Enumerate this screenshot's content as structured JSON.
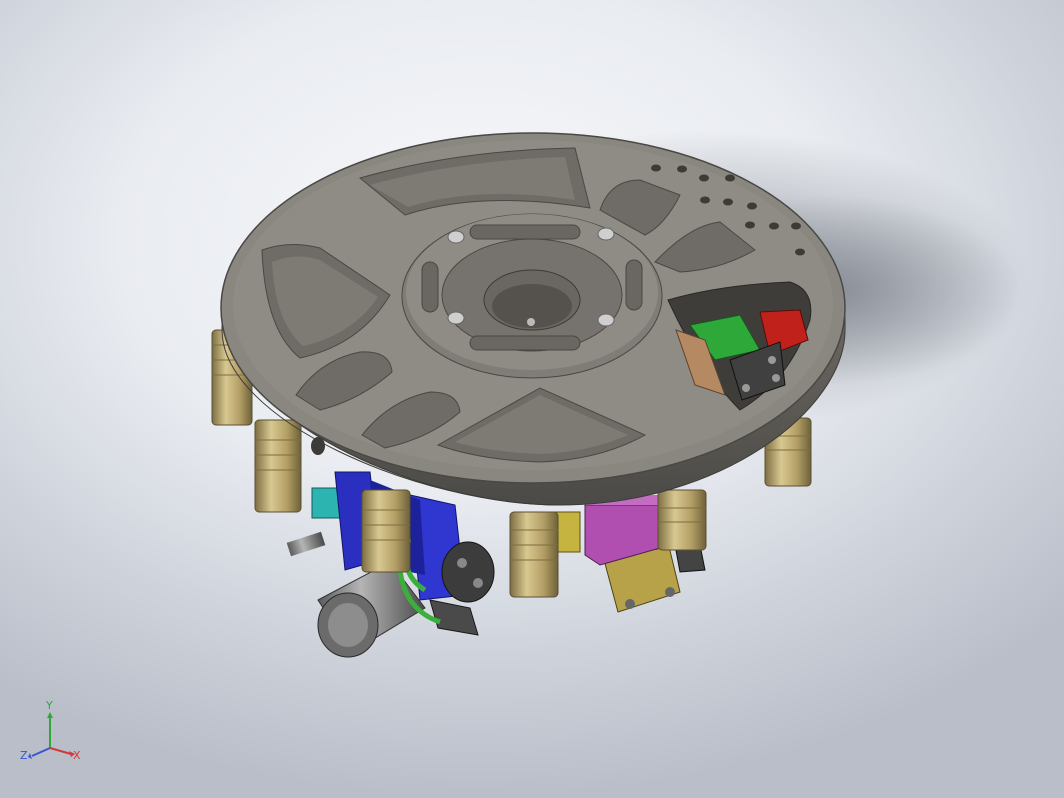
{
  "viewport": {
    "background_top": "#f5f6f8",
    "background_bottom": "#b9bec8"
  },
  "model": {
    "plate_color": "#8a8680",
    "plate_edge_color": "#5e5b56",
    "spacer_color": "#b6a36e",
    "bracket_blue": "#2a2fbf",
    "block_magenta": "#b04fb0",
    "block_olive": "#b7a24a",
    "block_green": "#2fa83a",
    "block_red": "#c0211b",
    "fitting_green": "#3cae3c",
    "connector_teal": "#2bb4b0"
  },
  "triad": {
    "y_label": "Y",
    "x_label": "X",
    "z_label": "Z",
    "y_color": "#2fa83a",
    "x_color": "#d23a3a",
    "z_color": "#3a55d2"
  }
}
